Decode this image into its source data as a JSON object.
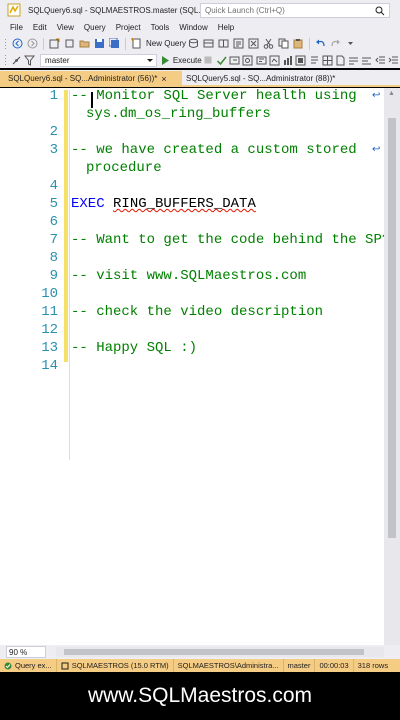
{
  "window": {
    "title": "SQLQuery6.sql - SQLMAESTROS.master (SQL...",
    "quick_launch_placeholder": "Quick Launch (Ctrl+Q)"
  },
  "menu": [
    "File",
    "Edit",
    "View",
    "Query",
    "Project",
    "Tools",
    "Window",
    "Help"
  ],
  "toolbar": {
    "new_query_label": "New Query",
    "database_selected": "master",
    "execute_label": "Execute"
  },
  "tabs": {
    "active": "SQLQuery6.sql - SQ...Administrator (56))*",
    "inactive": "SQLQuery5.sql - SQ...Administrator (88))*",
    "close_glyph": "×"
  },
  "editor": {
    "line_numbers": [
      "1",
      "2",
      "3",
      "4",
      "5",
      "6",
      "7",
      "8",
      "9",
      "10",
      "11",
      "12",
      "13",
      "14"
    ],
    "line1_a": "-- ",
    "line1_b": "Monitor SQL Server health using",
    "line1_cont": "sys.dm_os_ring_buffers",
    "line3": "-- we have created a custom stored",
    "line3_cont": "procedure",
    "line5_kw": "EXEC",
    "line5_ident": "RING_BUFFERS_DATA",
    "line7": "-- Want to get the code behind the SP?",
    "line9": "-- visit www.SQLMaestros.com",
    "line11": "-- check the video description",
    "line13": "-- Happy SQL :)"
  },
  "zoom": "90 %",
  "status": {
    "query": "Query ex...",
    "server": "SQLMAESTROS (15.0 RTM)",
    "user": "SQLMAESTROS\\Administra...",
    "database": "master",
    "time": "00:00:03",
    "rows": "318 rows"
  },
  "footer": "www.SQLMaestros.com",
  "colors": {
    "accent": "#f5cc84",
    "comment": "#008000",
    "keyword": "#0000ff",
    "line_number": "#2b91af"
  }
}
